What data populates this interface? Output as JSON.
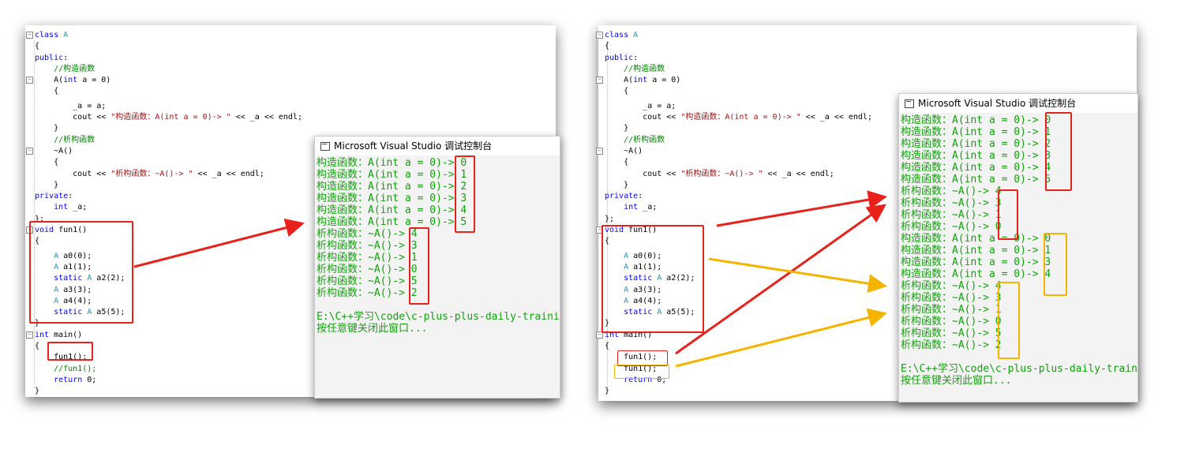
{
  "code_lines": [
    [
      {
        "t": "class ",
        "c": "kw"
      },
      {
        "t": "A",
        "c": "ty"
      }
    ],
    [
      {
        "t": "{",
        "c": ""
      }
    ],
    [
      {
        "t": "public",
        "c": "kw"
      },
      {
        "t": ":",
        "c": ""
      }
    ],
    [
      {
        "t": "    //构造函数",
        "c": "cm"
      }
    ],
    [
      {
        "t": "    A(",
        "c": ""
      },
      {
        "t": "int",
        "c": "kw"
      },
      {
        "t": " a = 0)",
        "c": ""
      }
    ],
    [
      {
        "t": "    {",
        "c": ""
      }
    ],
    [
      {
        "t": "        _a = a;",
        "c": ""
      }
    ],
    [
      {
        "t": "        cout << ",
        "c": ""
      },
      {
        "t": "\"构造函数：A(int a = 0)-> \"",
        "c": "st"
      },
      {
        "t": " << _a << endl;",
        "c": ""
      }
    ],
    [
      {
        "t": "    }",
        "c": ""
      }
    ],
    [
      {
        "t": "    //析构函数",
        "c": "cm"
      }
    ],
    [
      {
        "t": "    ~A()",
        "c": ""
      }
    ],
    [
      {
        "t": "    {",
        "c": ""
      }
    ],
    [
      {
        "t": "        cout << ",
        "c": ""
      },
      {
        "t": "\"析构函数：~A()-> \"",
        "c": "st"
      },
      {
        "t": " << _a << endl;",
        "c": ""
      }
    ],
    [
      {
        "t": "    }",
        "c": ""
      }
    ],
    [
      {
        "t": "private",
        "c": "kw"
      },
      {
        "t": ":",
        "c": ""
      }
    ],
    [
      {
        "t": "    ",
        "c": ""
      },
      {
        "t": "int",
        "c": "kw"
      },
      {
        "t": " _a;",
        "c": ""
      }
    ],
    [
      {
        "t": "};",
        "c": ""
      }
    ],
    [
      {
        "t": "void",
        "c": "kw"
      },
      {
        "t": " fun1()",
        "c": ""
      }
    ],
    [
      {
        "t": "{",
        "c": ""
      }
    ],
    [
      {
        "t": "    ",
        "c": ""
      },
      {
        "t": "A",
        "c": "ty"
      },
      {
        "t": " a0(0);",
        "c": ""
      }
    ],
    [
      {
        "t": "    ",
        "c": ""
      },
      {
        "t": "A",
        "c": "ty"
      },
      {
        "t": " a1(1);",
        "c": ""
      }
    ],
    [
      {
        "t": "    ",
        "c": ""
      },
      {
        "t": "static",
        "c": "kw"
      },
      {
        "t": " ",
        "c": ""
      },
      {
        "t": "A",
        "c": "ty"
      },
      {
        "t": " a2(2);",
        "c": ""
      }
    ],
    [
      {
        "t": "    ",
        "c": ""
      },
      {
        "t": "A",
        "c": "ty"
      },
      {
        "t": " a3(3);",
        "c": ""
      }
    ],
    [
      {
        "t": "    ",
        "c": ""
      },
      {
        "t": "A",
        "c": "ty"
      },
      {
        "t": " a4(4);",
        "c": ""
      }
    ],
    [
      {
        "t": "    ",
        "c": ""
      },
      {
        "t": "static",
        "c": "kw"
      },
      {
        "t": " ",
        "c": ""
      },
      {
        "t": "A",
        "c": "ty"
      },
      {
        "t": " a5(5);",
        "c": ""
      }
    ],
    [
      {
        "t": "}",
        "c": ""
      }
    ],
    [
      {
        "t": "int",
        "c": "kw"
      },
      {
        "t": " main()",
        "c": ""
      }
    ],
    [
      {
        "t": "{",
        "c": ""
      }
    ]
  ],
  "left": {
    "main_tail": [
      [
        {
          "t": "    fun1();",
          "c": ""
        }
      ],
      [
        {
          "t": "    //fun1();",
          "c": "cm"
        }
      ],
      [
        {
          "t": "    ",
          "c": ""
        },
        {
          "t": "return",
          "c": "kw"
        },
        {
          "t": " 0;",
          "c": ""
        }
      ],
      [
        {
          "t": "}",
          "c": ""
        }
      ]
    ],
    "console": {
      "title": "Microsoft Visual Studio 调试控制台",
      "lines": [
        "构造函数：A(int a = 0)-> 0",
        "构造函数：A(int a = 0)-> 1",
        "构造函数：A(int a = 0)-> 2",
        "构造函数：A(int a = 0)-> 3",
        "构造函数：A(int a = 0)-> 4",
        "构造函数：A(int a = 0)-> 5",
        "析构函数：~A()-> 4",
        "析构函数：~A()-> 3",
        "析构函数：~A()-> 1",
        "析构函数：~A()-> 0",
        "析构函数：~A()-> 5",
        "析构函数：~A()-> 2",
        "",
        "E:\\C++学习\\code\\c-plus-plus-daily-training",
        "按任意键关闭此窗口..."
      ]
    }
  },
  "right": {
    "main_tail": [
      [
        {
          "t": "    fun1();",
          "c": ""
        }
      ],
      [
        {
          "t": "    fun1();",
          "c": ""
        }
      ],
      [
        {
          "t": "    ",
          "c": ""
        },
        {
          "t": "return",
          "c": "kw"
        },
        {
          "t": " 0;",
          "c": ""
        }
      ],
      [
        {
          "t": "}",
          "c": ""
        }
      ]
    ],
    "console": {
      "title": "Microsoft Visual Studio 调试控制台",
      "lines": [
        "构造函数：A(int a = 0)-> 0",
        "构造函数：A(int a = 0)-> 1",
        "构造函数：A(int a = 0)-> 2",
        "构造函数：A(int a = 0)-> 3",
        "构造函数：A(int a = 0)-> 4",
        "构造函数：A(int a = 0)-> 5",
        "析构函数：~A()-> 4",
        "析构函数：~A()-> 3",
        "析构函数：~A()-> 1",
        "析构函数：~A()-> 0",
        "构造函数：A(int a = 0)-> 0",
        "构造函数：A(int a = 0)-> 1",
        "构造函数：A(int a = 0)-> 3",
        "构造函数：A(int a = 0)-> 4",
        "析构函数：~A()-> 4",
        "析构函数：~A()-> 3",
        "析构函数：~A()-> 1",
        "析构函数：~A()-> 0",
        "析构函数：~A()-> 5",
        "析构函数：~A()-> 2",
        "",
        "E:\\C++学习\\code\\c-plus-plus-daily-trainin",
        "按任意键关闭此窗口..."
      ]
    }
  },
  "colors": {
    "highlight_red": "#e8211b",
    "highlight_orange": "#f5b400",
    "console_text": "#13a10e"
  }
}
